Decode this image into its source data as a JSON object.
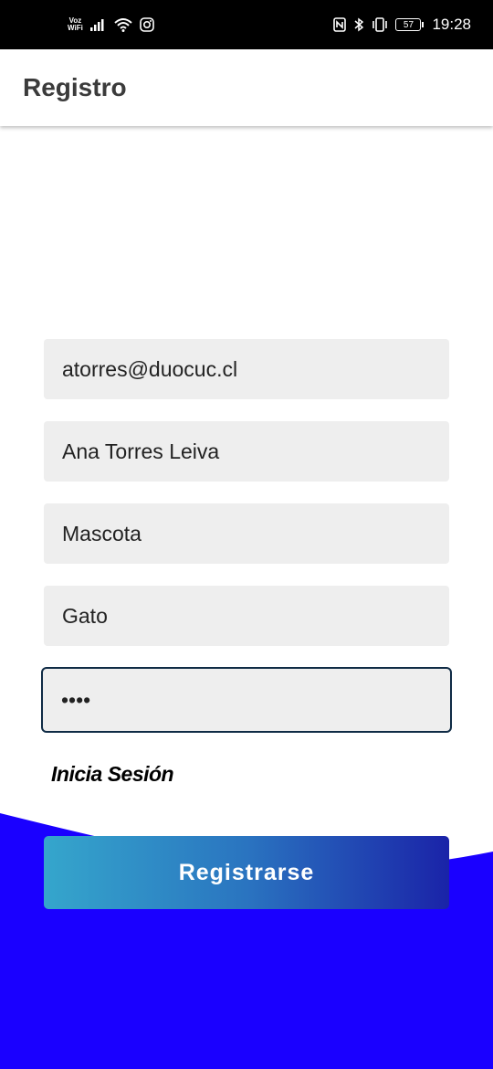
{
  "status_bar": {
    "voz_line1": "Voz",
    "voz_line2": "WiFi",
    "battery": "57",
    "time": "19:28"
  },
  "app_bar": {
    "title": "Registro"
  },
  "form": {
    "email": "atorres@duocuc.cl",
    "name": "Ana Torres Leiva",
    "field3": "Mascota",
    "field4": "Gato",
    "password": "••••"
  },
  "links": {
    "login": "Inicia Sesión"
  },
  "actions": {
    "register": "Registrarse"
  },
  "colors": {
    "wave": "#1a00ff",
    "button_start": "#35a6cc",
    "button_end": "#1a23a8",
    "active_border": "#0f2b45"
  }
}
